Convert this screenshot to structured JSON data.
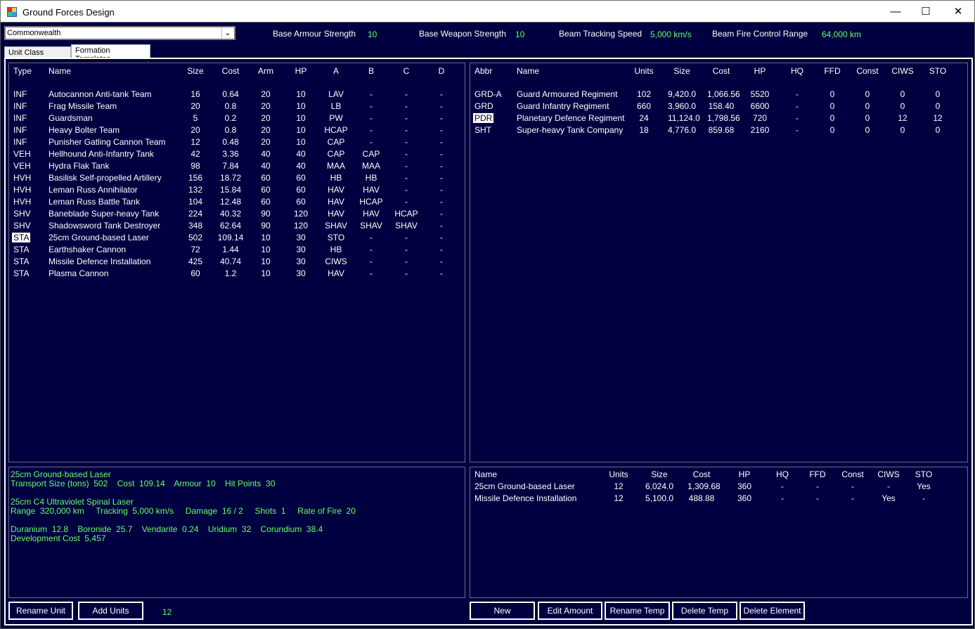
{
  "window": {
    "title": "Ground Forces Design",
    "minimize": "—",
    "maximize": "☐",
    "close": "✕"
  },
  "race": {
    "selected": "Commonwealth"
  },
  "stats": {
    "base_armour_label": "Base Armour Strength",
    "base_armour_value": "10",
    "base_weapon_label": "Base Weapon Strength",
    "base_weapon_value": "10",
    "beam_tracking_label": "Beam Tracking Speed",
    "beam_tracking_value": "5,000 km/s",
    "beam_fc_label": "Beam Fire Control Range",
    "beam_fc_value": "64,000 km"
  },
  "tabs": {
    "unit_class": "Unit Class Design",
    "formation": "Formation Templates"
  },
  "units": {
    "headers": [
      "Type",
      "Name",
      "Size",
      "Cost",
      "Arm",
      "HP",
      "A",
      "B",
      "C",
      "D"
    ],
    "rows": [
      [
        "INF",
        "Autocannon Anti-tank Team",
        "16",
        "0.64",
        "20",
        "10",
        "LAV",
        "-",
        "-",
        "-"
      ],
      [
        "INF",
        "Frag Missile Team",
        "20",
        "0.8",
        "20",
        "10",
        "LB",
        "-",
        "-",
        "-"
      ],
      [
        "INF",
        "Guardsman",
        "5",
        "0.2",
        "20",
        "10",
        "PW",
        "-",
        "-",
        "-"
      ],
      [
        "INF",
        "Heavy Bolter Team",
        "20",
        "0.8",
        "20",
        "10",
        "HCAP",
        "-",
        "-",
        "-"
      ],
      [
        "INF",
        "Punisher Gatling Cannon Team",
        "12",
        "0.48",
        "20",
        "10",
        "CAP",
        "-",
        "-",
        "-"
      ],
      [
        "VEH",
        "Hellhound Anti-Infantry Tank",
        "42",
        "3.36",
        "40",
        "40",
        "CAP",
        "CAP",
        "-",
        "-"
      ],
      [
        "VEH",
        "Hydra Flak Tank",
        "98",
        "7.84",
        "40",
        "40",
        "MAA",
        "MAA",
        "-",
        "-"
      ],
      [
        "HVH",
        "Basilisk Self-propelled Artillery",
        "156",
        "18.72",
        "60",
        "60",
        "HB",
        "HB",
        "-",
        "-"
      ],
      [
        "HVH",
        "Leman Russ Annihilator",
        "132",
        "15.84",
        "60",
        "60",
        "HAV",
        "HAV",
        "-",
        "-"
      ],
      [
        "HVH",
        "Leman Russ Battle Tank",
        "104",
        "12.48",
        "60",
        "60",
        "HAV",
        "HCAP",
        "-",
        "-"
      ],
      [
        "SHV",
        "Baneblade Super-heavy Tank",
        "224",
        "40.32",
        "90",
        "120",
        "HAV",
        "HAV",
        "HCAP",
        "-"
      ],
      [
        "SHV",
        "Shadowsword Tank Destroyer",
        "348",
        "62.64",
        "90",
        "120",
        "SHAV",
        "SHAV",
        "SHAV",
        "-"
      ],
      [
        "STA",
        "25cm Ground-based Laser",
        "502",
        "109.14",
        "10",
        "30",
        "STO",
        "-",
        "-",
        "-"
      ],
      [
        "STA",
        "Earthshaker Cannon",
        "72",
        "1.44",
        "10",
        "30",
        "HB",
        "-",
        "-",
        "-"
      ],
      [
        "STA",
        "Missile Defence Installation",
        "425",
        "40.74",
        "10",
        "30",
        "CIWS",
        "-",
        "-",
        "-"
      ],
      [
        "STA",
        "Plasma Cannon",
        "60",
        "1.2",
        "10",
        "30",
        "HAV",
        "-",
        "-",
        "-"
      ]
    ],
    "selected_index": 12
  },
  "templates": {
    "headers": [
      "Abbr",
      "Name",
      "Units",
      "Size",
      "Cost",
      "HP",
      "HQ",
      "FFD",
      "Const",
      "CIWS",
      "STO"
    ],
    "rows": [
      [
        "GRD-A",
        "Guard Armoured Regiment",
        "102",
        "9,420.0",
        "1,066.56",
        "5520",
        "-",
        "0",
        "0",
        "0",
        "0"
      ],
      [
        "GRD",
        "Guard Infantry Regiment",
        "660",
        "3,960.0",
        "158.40",
        "6600",
        "-",
        "0",
        "0",
        "0",
        "0"
      ],
      [
        "PDR",
        "Planetary Defence Regiment",
        "24",
        "11,124.0",
        "1,798.56",
        "720",
        "-",
        "0",
        "0",
        "12",
        "12"
      ],
      [
        "SHT",
        "Super-heavy Tank Company",
        "18",
        "4,776.0",
        "859.68",
        "2160",
        "-",
        "0",
        "0",
        "0",
        "0"
      ]
    ],
    "selected_index": 2
  },
  "details": {
    "lines": [
      "25cm Ground-based Laser",
      "Transport Size (tons)  502    Cost  109.14    Armour  10    Hit Points  30",
      "",
      "25cm C4 Ultraviolet Spinal Laser",
      "Range  320,000 km     Tracking  5,000 km/s     Damage  16 / 2     Shots  1     Rate of Fire  20",
      "",
      "Duranium  12.8    Boronide  25.7    Vendarite  0.24    Uridium  32    Corundium  38.4",
      "Development Cost  5,457"
    ]
  },
  "elements": {
    "headers": [
      "Name",
      "Units",
      "Size",
      "Cost",
      "HP",
      "HQ",
      "FFD",
      "Const",
      "CIWS",
      "STO"
    ],
    "rows": [
      [
        "25cm Ground-based Laser",
        "12",
        "6,024.0",
        "1,309.68",
        "360",
        "-",
        "-",
        "-",
        "-",
        "Yes"
      ],
      [
        "Missile Defence Installation",
        "12",
        "5,100.0",
        "488.88",
        "360",
        "-",
        "-",
        "-",
        "Yes",
        "-"
      ]
    ]
  },
  "buttons": {
    "rename_unit": "Rename Unit",
    "add_units": "Add Units",
    "add_units_count": "12",
    "new": "New",
    "edit_amount": "Edit Amount",
    "rename_temp": "Rename Temp",
    "delete_temp": "Delete Temp",
    "delete_element": "Delete Element"
  },
  "colors": {
    "background": "#000040",
    "highlight_text": "#66ff66",
    "text": "#ffffff"
  }
}
